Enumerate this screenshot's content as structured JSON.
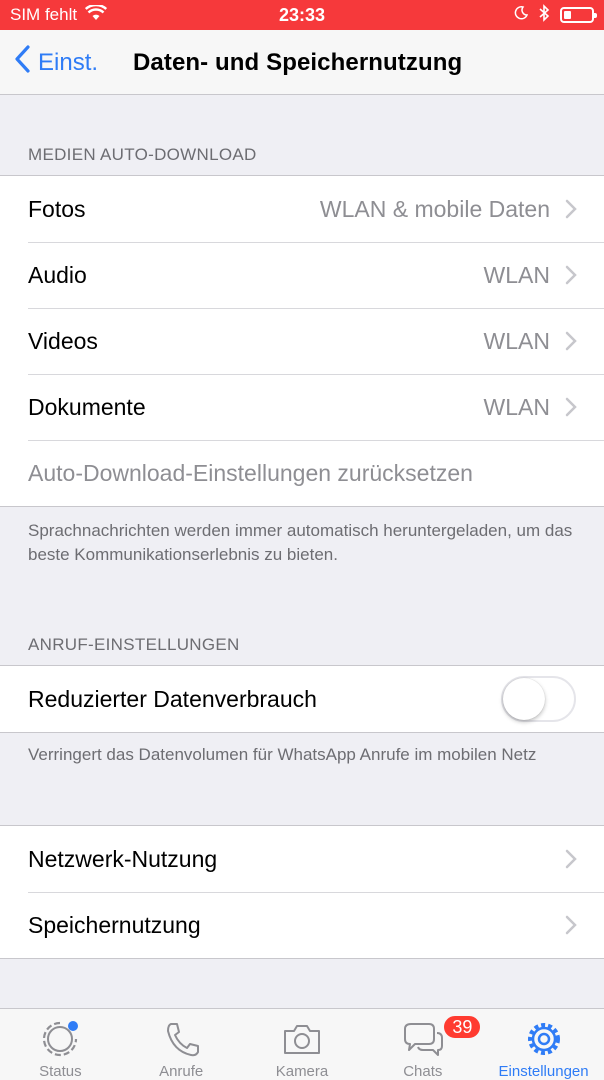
{
  "status_bar": {
    "carrier": "SIM fehlt",
    "time": "23:33"
  },
  "nav": {
    "back_label": "Einst.",
    "title": "Daten- und Speichernutzung"
  },
  "media_section": {
    "header": "MEDIEN AUTO-DOWNLOAD",
    "rows": [
      {
        "label": "Fotos",
        "value": "WLAN & mobile Daten"
      },
      {
        "label": "Audio",
        "value": "WLAN"
      },
      {
        "label": "Videos",
        "value": "WLAN"
      },
      {
        "label": "Dokumente",
        "value": "WLAN"
      }
    ],
    "reset_label": "Auto-Download-Einstellungen zurücksetzen",
    "footer": "Sprachnachrichten werden immer automatisch heruntergeladen, um das beste Kommunikationserlebnis zu bieten."
  },
  "call_section": {
    "header": "ANRUF-EINSTELLUNGEN",
    "low_data_label": "Reduzierter Datenverbrauch",
    "low_data_enabled": false,
    "footer": "Verringert das Datenvolumen für WhatsApp Anrufe im mobilen Netz"
  },
  "usage_section": {
    "rows": [
      {
        "label": "Netzwerk-Nutzung"
      },
      {
        "label": "Speichernutzung"
      }
    ]
  },
  "tab_bar": {
    "tabs": [
      {
        "label": "Status",
        "icon": "status-icon"
      },
      {
        "label": "Anrufe",
        "icon": "phone-icon"
      },
      {
        "label": "Kamera",
        "icon": "camera-icon"
      },
      {
        "label": "Chats",
        "icon": "chats-icon",
        "badge": "39"
      },
      {
        "label": "Einstellungen",
        "icon": "gear-icon",
        "active": true
      }
    ]
  },
  "colors": {
    "status_bar": "#f6393b",
    "accent": "#2f7cf6",
    "badge": "#ff3b30"
  }
}
